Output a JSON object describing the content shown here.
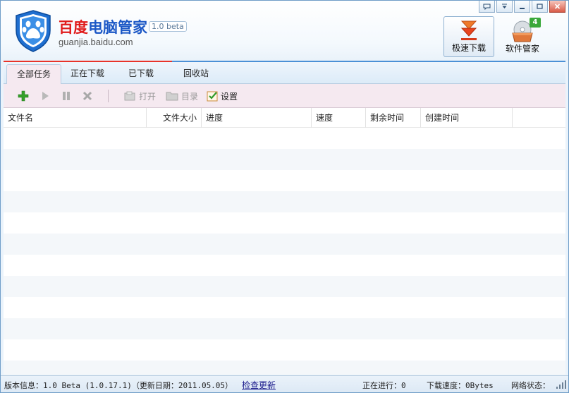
{
  "brand": {
    "title_red": "百度",
    "title_blue": "电脑管家",
    "version": "1.0 beta",
    "url": "guanjia.baidu.com"
  },
  "window_controls": {
    "feedback_icon": "speech-bubble-icon",
    "menu_icon": "dropdown-menu-icon",
    "minimize_icon": "minimize-icon",
    "maximize_icon": "maximize-icon",
    "close_icon": "close-icon"
  },
  "features": {
    "fast_download": "极速下载",
    "software_manager": "软件管家",
    "software_badge": "4"
  },
  "tabs": [
    {
      "label": "全部任务",
      "active": true
    },
    {
      "label": "正在下载",
      "active": false
    },
    {
      "label": "已下载",
      "active": false
    },
    {
      "label": "回收站",
      "active": false
    }
  ],
  "toolbar": {
    "add_icon": "plus-icon",
    "start_icon": "play-icon",
    "pause_icon": "pause-icon",
    "delete_icon": "x-icon",
    "open_label": "打开",
    "folder_label": "目录",
    "settings_label": "设置"
  },
  "grid": {
    "columns": [
      "文件名",
      "文件大小",
      "进度",
      "速度",
      "剩余时间",
      "创建时间"
    ],
    "row_count": 12
  },
  "status": {
    "version_info": "版本信息：1.0 Beta (1.0.17.1)（更新日期：2011.05.05）",
    "check_update": "检查更新",
    "in_progress": "正在进行：0",
    "download_speed": "下载速度：0Bytes",
    "network_status": "网络状态："
  },
  "colors": {
    "accent_red": "#e01b1b",
    "accent_blue": "#1c58c6",
    "tab_active_bg": "#f5e9f0",
    "badge_green": "#3aa83a"
  }
}
